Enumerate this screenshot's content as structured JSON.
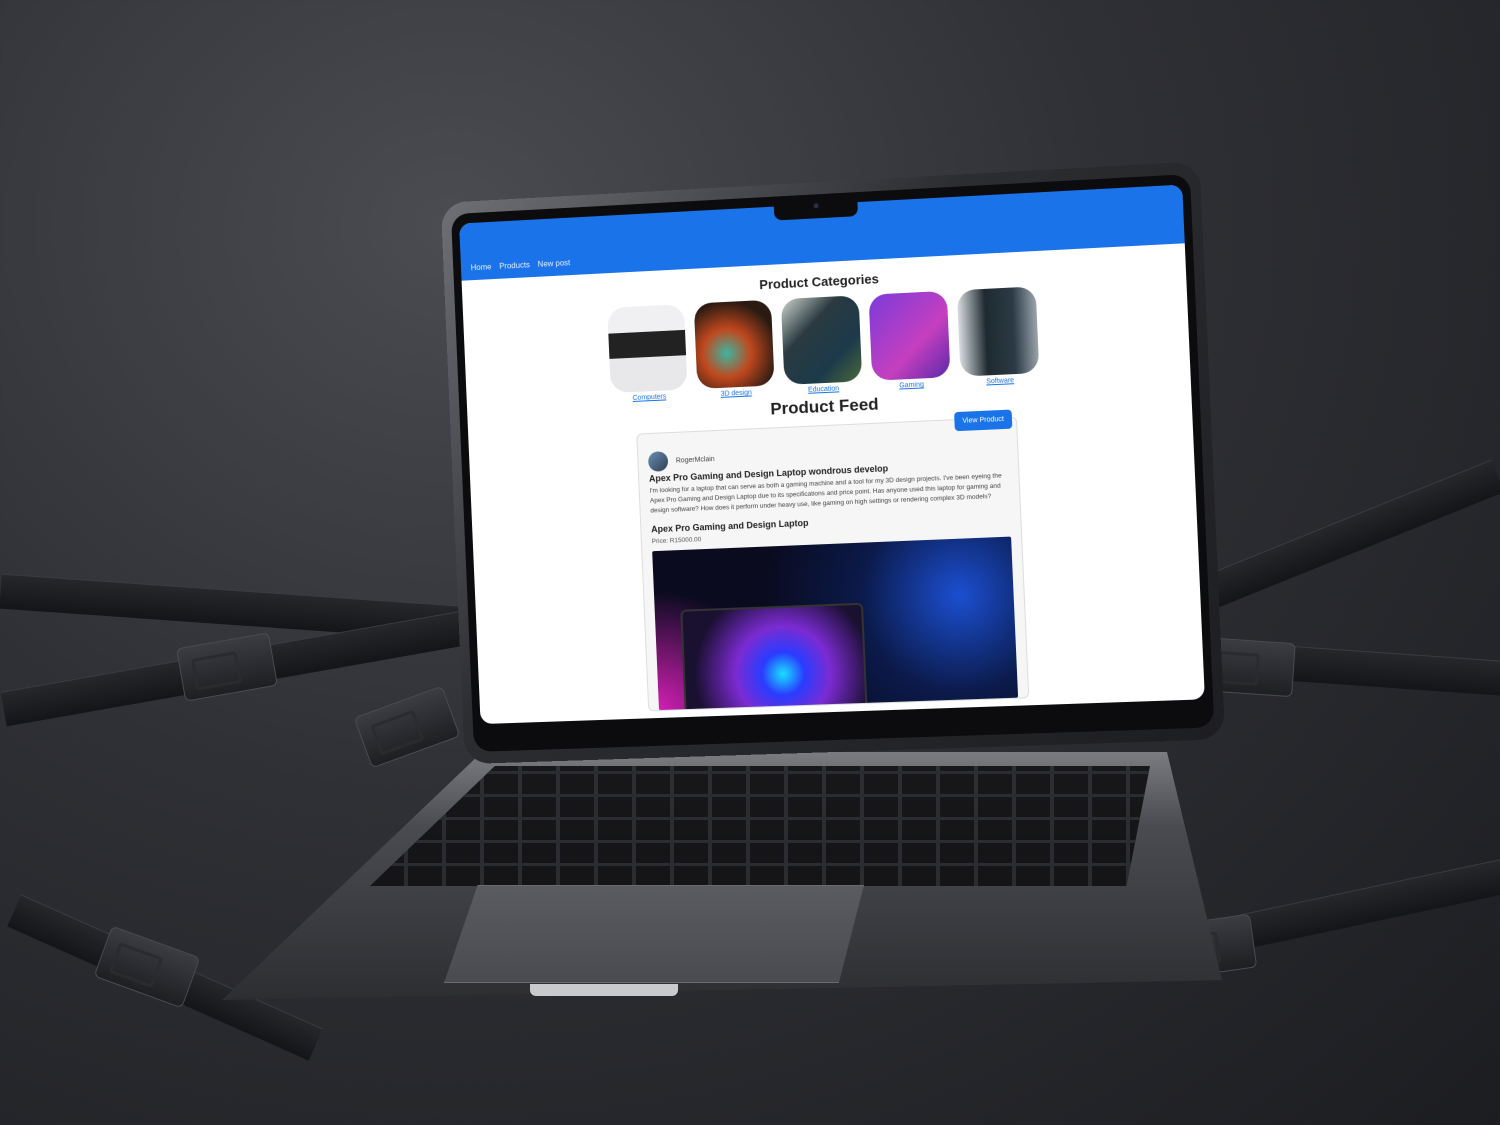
{
  "nav": {
    "links": [
      "Home",
      "Products",
      "New post"
    ]
  },
  "categories": {
    "title": "Product Categories",
    "items": [
      {
        "label": "Computers",
        "icon": "computers-thumbnail"
      },
      {
        "label": "3D design",
        "icon": "3d-design-thumbnail"
      },
      {
        "label": "Education",
        "icon": "education-thumbnail"
      },
      {
        "label": "Gaming",
        "icon": "gaming-thumbnail"
      },
      {
        "label": "Software",
        "icon": "software-thumbnail"
      }
    ]
  },
  "feed": {
    "title": "Product Feed",
    "post": {
      "view_button": "View Product",
      "author": "RogerMclain",
      "title": "Apex Pro Gaming and Design Laptop wondrous develop",
      "body": "I'm looking for a laptop that can serve as both a gaming machine and a tool for my 3D design projects. I've been eyeing the Apex Pro Gaming and Design Laptop due to its specifications and price point. Has anyone used this laptop for gaming and design software? How does it perform under heavy use, like gaming on high settings or rendering complex 3D models?",
      "product_name": "Apex Pro Gaming and Design Laptop",
      "price": "Price: R15000.00"
    }
  },
  "colors": {
    "navbar": "#1a73e8",
    "link": "#1a73e8",
    "button": "#1a73e8"
  }
}
